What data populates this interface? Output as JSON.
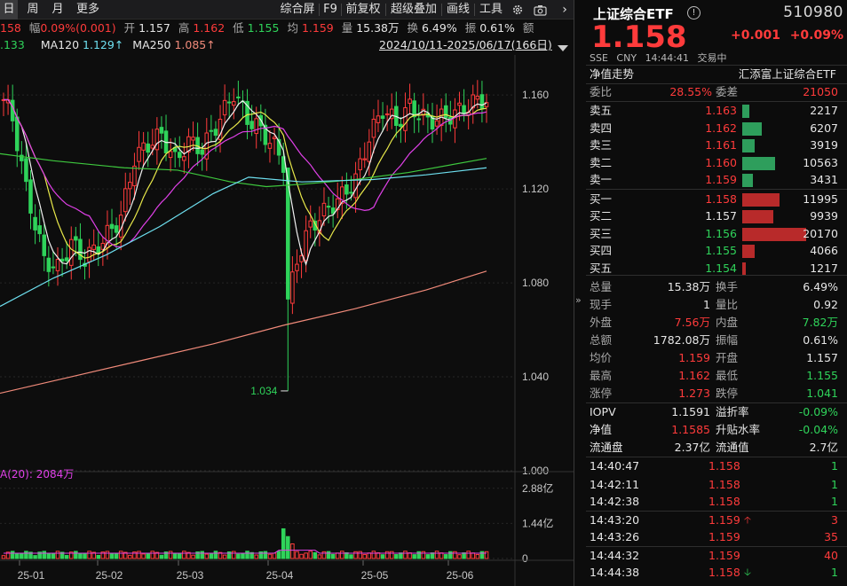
{
  "toolbar": {
    "left_tabs": [
      "日",
      "周",
      "月",
      "更多"
    ],
    "right_items": [
      "综合屏",
      "F9",
      "前复权",
      "超级叠加",
      "画线",
      "工具"
    ]
  },
  "ohlc": {
    "close_partial": "158",
    "amp_label": "幅",
    "amp_value": "0.09%(0.001)",
    "open_label": "开",
    "open_value": "1.157",
    "high_label": "高",
    "high_value": "1.162",
    "low_label": "低",
    "low_value": "1.155",
    "avg_label": "均",
    "avg_value": "1.159",
    "vol_label": "量",
    "vol_value": "15.38万",
    "turn_label": "换",
    "turn_value": "6.49%",
    "swing_label": "振",
    "swing_value": "0.61%",
    "amount_label": "额"
  },
  "ma_row": {
    "ma_first_partial": ".133",
    "ma120_label": "MA120",
    "ma120_value": "1.129",
    "ma250_label": "MA250",
    "ma250_value": "1.085",
    "range_text": "2024/10/11-2025/06/17(166日)"
  },
  "chart_data": {
    "type": "candlestick",
    "y_axis_ticks": [
      "1.160",
      "1.120",
      "1.080",
      "1.040",
      "1.000"
    ],
    "y_ticks_values": [
      1.16,
      1.12,
      1.08,
      1.04,
      1.0
    ],
    "ylim": [
      0.98,
      1.171
    ],
    "x_labels": [
      "25-01",
      "25-02",
      "25-03",
      "25-04",
      "25-05",
      "25-06"
    ],
    "low_annotation": "1.034",
    "volume_ma_label": "A(20): 2084万",
    "volume_axis_ticks": [
      "2.88亿",
      "1.44亿",
      "0"
    ],
    "volume_ylim": [
      0,
      3.2
    ],
    "colors": {
      "up": "#ff3b3b",
      "down": "#2fd35a",
      "ma5": "#f0f0f0",
      "ma10": "#e8e84a",
      "ma20": "#e040e8",
      "ma60": "#3ec83e",
      "ma120": "#6ee0f0",
      "ma250": "#f08a7a"
    }
  },
  "quote": {
    "name": "上证综合ETF",
    "code": "510980",
    "price": "1.158",
    "change": "+0.001",
    "change_pct": "+0.09%",
    "meta": [
      "SSE",
      "CNY",
      "14:44:41",
      "交易中"
    ],
    "nav_trend_label": "净值走势",
    "fund_name": "汇添富上证综合ETF",
    "weibi_label": "委比",
    "weibi_value": "28.55%",
    "weicha_label": "委差",
    "weicha_value": "21050"
  },
  "orderbook": {
    "asks": [
      {
        "label": "卖五",
        "price": "1.163",
        "vol": "2217",
        "ratio": 0.11
      },
      {
        "label": "卖四",
        "price": "1.162",
        "vol": "6207",
        "ratio": 0.31
      },
      {
        "label": "卖三",
        "price": "1.161",
        "vol": "3919",
        "ratio": 0.19
      },
      {
        "label": "卖二",
        "price": "1.160",
        "vol": "10563",
        "ratio": 0.52
      },
      {
        "label": "卖一",
        "price": "1.159",
        "vol": "3431",
        "ratio": 0.17
      }
    ],
    "bids": [
      {
        "label": "买一",
        "price": "1.158",
        "vol": "11995",
        "ratio": 0.59
      },
      {
        "label": "买二",
        "price": "1.157",
        "vol": "9939",
        "ratio": 0.49
      },
      {
        "label": "买三",
        "price": "1.156",
        "vol": "20170",
        "ratio": 1.0
      },
      {
        "label": "买四",
        "price": "1.155",
        "vol": "4066",
        "ratio": 0.2
      },
      {
        "label": "买五",
        "price": "1.154",
        "vol": "1217",
        "ratio": 0.06
      }
    ]
  },
  "stats": [
    {
      "l1": "总量",
      "v1": "15.38万",
      "c1": "white",
      "l2": "换手",
      "v2": "6.49%",
      "c2": "white"
    },
    {
      "l1": "现手",
      "v1": "1",
      "c1": "white",
      "l2": "量比",
      "v2": "0.92",
      "c2": "white"
    },
    {
      "l1": "外盘",
      "v1": "7.56万",
      "c1": "red",
      "l2": "内盘",
      "v2": "7.82万",
      "c2": "green"
    },
    {
      "l1": "总额",
      "v1": "1782.08万",
      "c1": "white",
      "l2": "振幅",
      "v2": "0.61%",
      "c2": "white"
    },
    {
      "l1": "均价",
      "v1": "1.159",
      "c1": "red",
      "l2": "开盘",
      "v2": "1.157",
      "c2": "white"
    },
    {
      "l1": "最高",
      "v1": "1.162",
      "c1": "red",
      "l2": "最低",
      "v2": "1.155",
      "c2": "green"
    },
    {
      "l1": "涨停",
      "v1": "1.273",
      "c1": "red",
      "l2": "跌停",
      "v2": "1.041",
      "c2": "green"
    }
  ],
  "iopv": [
    {
      "l1": "IOPV",
      "v1": "1.1591",
      "c1": "white",
      "l2": "溢折率",
      "v2": "-0.09%",
      "c2": "green"
    },
    {
      "l1": "净值",
      "v1": "1.1585",
      "c1": "red",
      "l2": "升贴水率",
      "v2": "-0.04%",
      "c2": "green"
    },
    {
      "l1": "流通盘",
      "v1": "2.37亿",
      "c1": "white",
      "l2": "流通值",
      "v2": "2.7亿",
      "c2": "white"
    }
  ],
  "ticks": [
    {
      "time": "14:40:47",
      "price": "1.158",
      "arrow": "",
      "vol": "1",
      "vcolor": "green"
    },
    {
      "time": "14:42:11",
      "price": "1.158",
      "arrow": "",
      "vol": "1",
      "vcolor": "green"
    },
    {
      "time": "14:42:38",
      "price": "1.158",
      "arrow": "",
      "vol": "1",
      "vcolor": "green"
    },
    {
      "time": "14:43:20",
      "price": "1.159",
      "arrow": "up",
      "vol": "3",
      "vcolor": "red"
    },
    {
      "time": "14:43:26",
      "price": "1.159",
      "arrow": "",
      "vol": "35",
      "vcolor": "red"
    },
    {
      "time": "14:44:32",
      "price": "1.159",
      "arrow": "",
      "vol": "40",
      "vcolor": "red"
    },
    {
      "time": "14:44:38",
      "price": "1.158",
      "arrow": "down",
      "vol": "1",
      "vcolor": "green"
    }
  ]
}
